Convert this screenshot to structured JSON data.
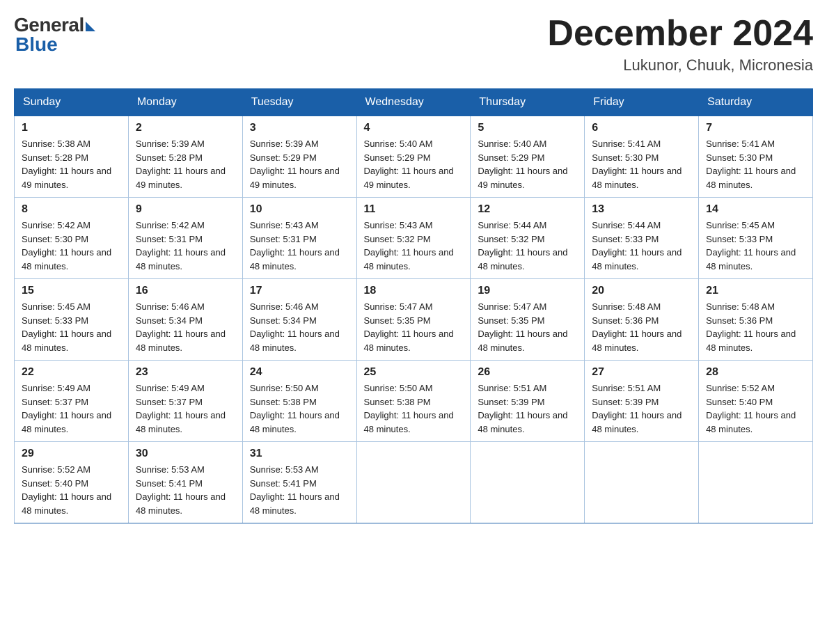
{
  "logo": {
    "general": "General",
    "blue": "Blue"
  },
  "title": {
    "month": "December 2024",
    "location": "Lukunor, Chuuk, Micronesia"
  },
  "days_of_week": [
    "Sunday",
    "Monday",
    "Tuesday",
    "Wednesday",
    "Thursday",
    "Friday",
    "Saturday"
  ],
  "weeks": [
    [
      {
        "day": "1",
        "sunrise": "5:38 AM",
        "sunset": "5:28 PM",
        "daylight": "11 hours and 49 minutes."
      },
      {
        "day": "2",
        "sunrise": "5:39 AM",
        "sunset": "5:28 PM",
        "daylight": "11 hours and 49 minutes."
      },
      {
        "day": "3",
        "sunrise": "5:39 AM",
        "sunset": "5:29 PM",
        "daylight": "11 hours and 49 minutes."
      },
      {
        "day": "4",
        "sunrise": "5:40 AM",
        "sunset": "5:29 PM",
        "daylight": "11 hours and 49 minutes."
      },
      {
        "day": "5",
        "sunrise": "5:40 AM",
        "sunset": "5:29 PM",
        "daylight": "11 hours and 49 minutes."
      },
      {
        "day": "6",
        "sunrise": "5:41 AM",
        "sunset": "5:30 PM",
        "daylight": "11 hours and 48 minutes."
      },
      {
        "day": "7",
        "sunrise": "5:41 AM",
        "sunset": "5:30 PM",
        "daylight": "11 hours and 48 minutes."
      }
    ],
    [
      {
        "day": "8",
        "sunrise": "5:42 AM",
        "sunset": "5:30 PM",
        "daylight": "11 hours and 48 minutes."
      },
      {
        "day": "9",
        "sunrise": "5:42 AM",
        "sunset": "5:31 PM",
        "daylight": "11 hours and 48 minutes."
      },
      {
        "day": "10",
        "sunrise": "5:43 AM",
        "sunset": "5:31 PM",
        "daylight": "11 hours and 48 minutes."
      },
      {
        "day": "11",
        "sunrise": "5:43 AM",
        "sunset": "5:32 PM",
        "daylight": "11 hours and 48 minutes."
      },
      {
        "day": "12",
        "sunrise": "5:44 AM",
        "sunset": "5:32 PM",
        "daylight": "11 hours and 48 minutes."
      },
      {
        "day": "13",
        "sunrise": "5:44 AM",
        "sunset": "5:33 PM",
        "daylight": "11 hours and 48 minutes."
      },
      {
        "day": "14",
        "sunrise": "5:45 AM",
        "sunset": "5:33 PM",
        "daylight": "11 hours and 48 minutes."
      }
    ],
    [
      {
        "day": "15",
        "sunrise": "5:45 AM",
        "sunset": "5:33 PM",
        "daylight": "11 hours and 48 minutes."
      },
      {
        "day": "16",
        "sunrise": "5:46 AM",
        "sunset": "5:34 PM",
        "daylight": "11 hours and 48 minutes."
      },
      {
        "day": "17",
        "sunrise": "5:46 AM",
        "sunset": "5:34 PM",
        "daylight": "11 hours and 48 minutes."
      },
      {
        "day": "18",
        "sunrise": "5:47 AM",
        "sunset": "5:35 PM",
        "daylight": "11 hours and 48 minutes."
      },
      {
        "day": "19",
        "sunrise": "5:47 AM",
        "sunset": "5:35 PM",
        "daylight": "11 hours and 48 minutes."
      },
      {
        "day": "20",
        "sunrise": "5:48 AM",
        "sunset": "5:36 PM",
        "daylight": "11 hours and 48 minutes."
      },
      {
        "day": "21",
        "sunrise": "5:48 AM",
        "sunset": "5:36 PM",
        "daylight": "11 hours and 48 minutes."
      }
    ],
    [
      {
        "day": "22",
        "sunrise": "5:49 AM",
        "sunset": "5:37 PM",
        "daylight": "11 hours and 48 minutes."
      },
      {
        "day": "23",
        "sunrise": "5:49 AM",
        "sunset": "5:37 PM",
        "daylight": "11 hours and 48 minutes."
      },
      {
        "day": "24",
        "sunrise": "5:50 AM",
        "sunset": "5:38 PM",
        "daylight": "11 hours and 48 minutes."
      },
      {
        "day": "25",
        "sunrise": "5:50 AM",
        "sunset": "5:38 PM",
        "daylight": "11 hours and 48 minutes."
      },
      {
        "day": "26",
        "sunrise": "5:51 AM",
        "sunset": "5:39 PM",
        "daylight": "11 hours and 48 minutes."
      },
      {
        "day": "27",
        "sunrise": "5:51 AM",
        "sunset": "5:39 PM",
        "daylight": "11 hours and 48 minutes."
      },
      {
        "day": "28",
        "sunrise": "5:52 AM",
        "sunset": "5:40 PM",
        "daylight": "11 hours and 48 minutes."
      }
    ],
    [
      {
        "day": "29",
        "sunrise": "5:52 AM",
        "sunset": "5:40 PM",
        "daylight": "11 hours and 48 minutes."
      },
      {
        "day": "30",
        "sunrise": "5:53 AM",
        "sunset": "5:41 PM",
        "daylight": "11 hours and 48 minutes."
      },
      {
        "day": "31",
        "sunrise": "5:53 AM",
        "sunset": "5:41 PM",
        "daylight": "11 hours and 48 minutes."
      },
      null,
      null,
      null,
      null
    ]
  ]
}
